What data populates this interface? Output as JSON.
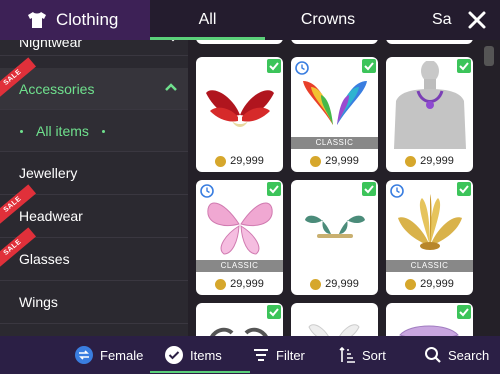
{
  "header": {
    "title": "Clothing",
    "tabs": [
      {
        "label": "All",
        "active": true
      },
      {
        "label": "Crowns",
        "active": false
      },
      {
        "label": "Sa",
        "active": false
      }
    ]
  },
  "sidebar": {
    "items": [
      {
        "label": "Nightwear",
        "sale": false
      },
      {
        "label": "Accessories",
        "sale": true
      },
      {
        "label": "All items",
        "sale": false
      },
      {
        "label": "Jewellery",
        "sale": false
      },
      {
        "label": "Headwear",
        "sale": true
      },
      {
        "label": "Glasses",
        "sale": true
      },
      {
        "label": "Wings",
        "sale": false
      }
    ],
    "sale_text": "SALE"
  },
  "grid": {
    "classic_label": "CLASSIC",
    "cards": [
      {
        "name": "Red Wings",
        "price": "29,999",
        "classic": false,
        "clock": false
      },
      {
        "name": "Rainbow Wings",
        "price": "29,999",
        "classic": true,
        "clock": true
      },
      {
        "name": "Purple Necklace",
        "price": "29,999",
        "classic": false,
        "clock": false
      },
      {
        "name": "Pink Fairy Wings",
        "price": "29,999",
        "classic": true,
        "clock": true
      },
      {
        "name": "Green Wing Ornament",
        "price": "29,999",
        "classic": false,
        "clock": false
      },
      {
        "name": "Gold Feather Crown",
        "price": "29,999",
        "classic": true,
        "clock": true
      }
    ]
  },
  "bottombar": {
    "female_label": "Female",
    "items_label": "Items",
    "filter_label": "Filter",
    "sort_label": "Sort",
    "search_label": "Search"
  }
}
